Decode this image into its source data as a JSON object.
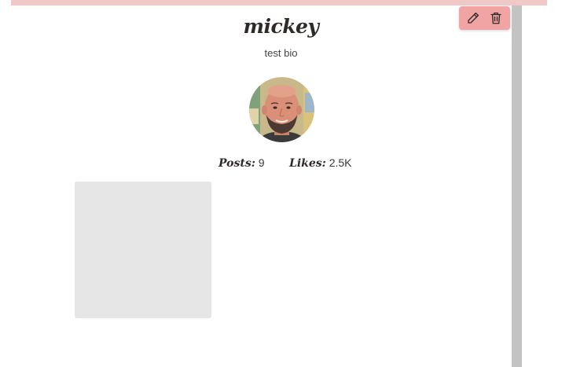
{
  "profile": {
    "username": "mickey",
    "bio": "test bio"
  },
  "stats": {
    "posts_label": "Posts:",
    "posts_value": "9",
    "likes_label": "Likes:",
    "likes_value": "2.5K"
  },
  "actions": {
    "edit_icon": "pencil-icon",
    "delete_icon": "trash-icon"
  },
  "posts": [
    {}
  ],
  "colors": {
    "top_band": "#f0c8c8",
    "action_bar": "#f0a4a4",
    "scrollbar": "#c3c3c3",
    "post_placeholder": "#e6e6e6"
  }
}
